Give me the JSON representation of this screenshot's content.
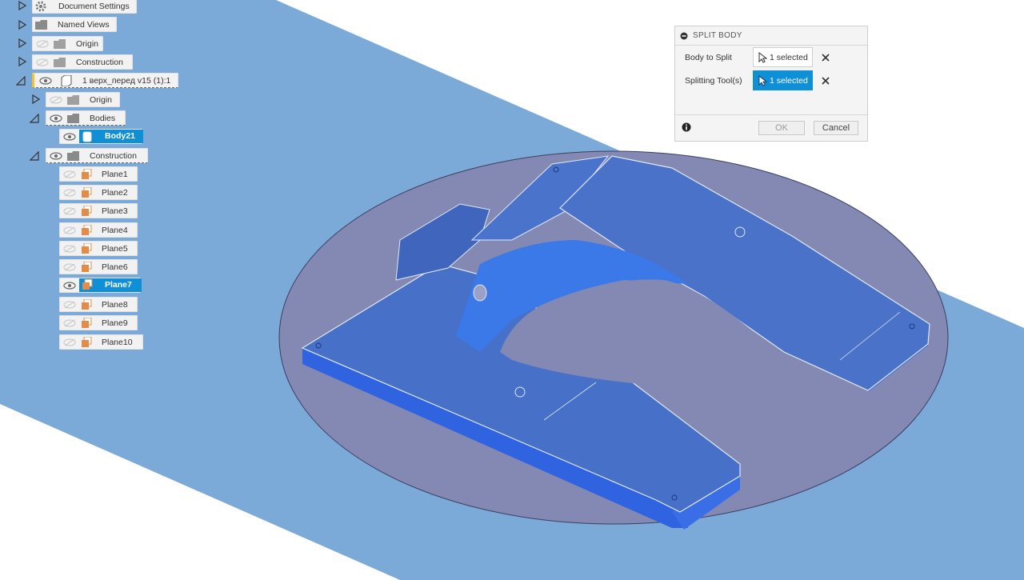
{
  "browser": {
    "items": [
      {
        "label": "Document Settings"
      },
      {
        "label": "Named Views"
      },
      {
        "label": "Origin"
      },
      {
        "label": "Construction"
      },
      {
        "label": "1 верх_перед v15 (1):1"
      },
      {
        "label": "Origin"
      },
      {
        "label": "Bodies"
      },
      {
        "label": "Body21"
      },
      {
        "label": "Construction"
      },
      {
        "label": "Plane1"
      },
      {
        "label": "Plane2"
      },
      {
        "label": "Plane3"
      },
      {
        "label": "Plane4"
      },
      {
        "label": "Plane5"
      },
      {
        "label": "Plane6"
      },
      {
        "label": "Plane7"
      },
      {
        "label": "Plane8"
      },
      {
        "label": "Plane9"
      },
      {
        "label": "Plane10"
      }
    ]
  },
  "dialog": {
    "title": "SPLIT BODY",
    "rows": [
      {
        "label": "Body to Split",
        "value": "1 selected"
      },
      {
        "label": "Splitting Tool(s)",
        "value": "1 selected"
      }
    ],
    "ok_label": "OK",
    "cancel_label": "Cancel"
  },
  "colors": {
    "plane": "#7ba9d8",
    "body": "#3d6fd6",
    "ellipse": "#8389b3",
    "cut_region": "#ff9a9a",
    "selection": "#0f8fd6",
    "plane_icon": "#e28c4a"
  }
}
